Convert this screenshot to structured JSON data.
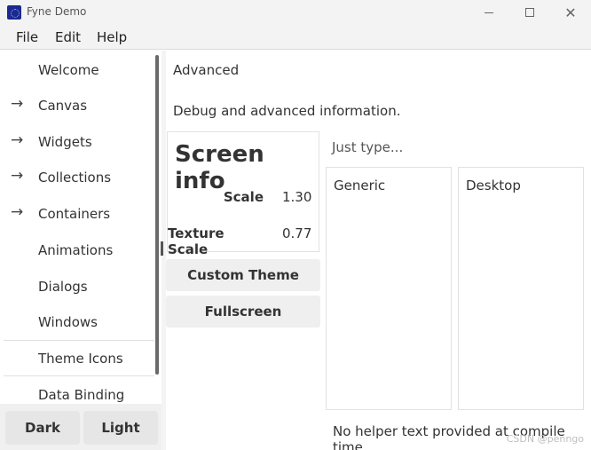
{
  "window": {
    "title": "Fyne Demo",
    "controls": {
      "minimize": "—",
      "maximize": "□",
      "close": "✕"
    }
  },
  "menu": [
    {
      "label": "File"
    },
    {
      "label": "Edit"
    },
    {
      "label": "Help"
    }
  ],
  "sidebar": {
    "items": [
      {
        "label": "Welcome",
        "has_children": false
      },
      {
        "label": "Canvas",
        "has_children": true
      },
      {
        "label": "Widgets",
        "has_children": true
      },
      {
        "label": "Collections",
        "has_children": true
      },
      {
        "label": "Containers",
        "has_children": true
      },
      {
        "label": "Animations",
        "has_children": false
      },
      {
        "label": "Dialogs",
        "has_children": false
      },
      {
        "label": "Windows",
        "has_children": false
      },
      {
        "label": "Theme Icons",
        "has_children": false
      },
      {
        "label": "Data Binding",
        "has_children": false
      }
    ],
    "theme_buttons": {
      "dark": "Dark",
      "light": "Light"
    }
  },
  "main": {
    "title": "Advanced",
    "description": "Debug and advanced information.",
    "screen_info": {
      "title": "Screen info",
      "rows": [
        {
          "key": "Scale",
          "value": "1.30"
        },
        {
          "key": "Texture Scale",
          "value": "0.77"
        }
      ]
    },
    "buttons": {
      "custom_theme": "Custom Theme",
      "fullscreen": "Fullscreen"
    },
    "entry_placeholder": "Just type...",
    "lists": [
      {
        "label": "Generic"
      },
      {
        "label": "Desktop"
      }
    ],
    "helper_text": "No helper text provided at compile time."
  },
  "watermark": "CSDN @penngo",
  "colors": {
    "app_icon": "#1b2a8f",
    "chrome": "#f3f3f3",
    "button_bg": "#efefef"
  }
}
